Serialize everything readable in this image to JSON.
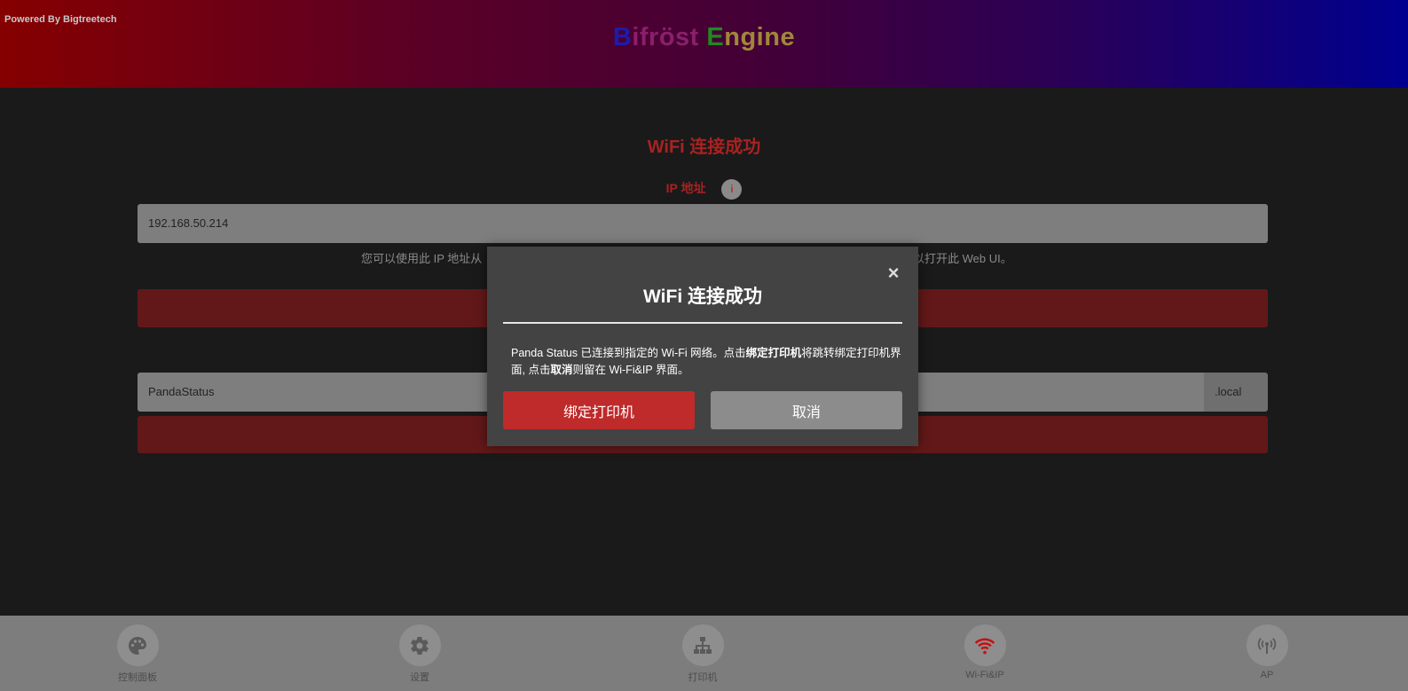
{
  "header": {
    "powered_by": "Powered By Bigtreetech",
    "brand_parts": [
      "B",
      "ifröst",
      " E",
      "ngine"
    ]
  },
  "main": {
    "title": "WiFi 连接成功",
    "ip_label": "IP 地址",
    "info_icon": "i",
    "ip_value": "192.168.50.214",
    "ip_hint_left": "您可以使用此 IP 地址从",
    "ip_hint_right": "中，以打开此 Web UI。",
    "hostname_value": "PandaStatus",
    "hostname_suffix": ".local"
  },
  "modal": {
    "title": "WiFi 连接成功",
    "close_icon": "×",
    "body_part1": "Panda Status 已连接到指定的 Wi-Fi 网络。点击",
    "body_bold1": "绑定打印机",
    "body_part2": "将跳转绑定打印机界面, 点击",
    "body_bold2": "取消",
    "body_part3": "则留在 Wi-Fi&IP 界面。",
    "bind_button": "绑定打印机",
    "cancel_button": "取消"
  },
  "nav": {
    "items": [
      {
        "label": "控制面板",
        "icon": "palette-icon"
      },
      {
        "label": "设置",
        "icon": "gear-icon"
      },
      {
        "label": "打印机",
        "icon": "sitemap-icon"
      },
      {
        "label": "Wi-Fi&IP",
        "icon": "wifi-icon"
      },
      {
        "label": "AP",
        "icon": "broadcast-icon"
      }
    ]
  },
  "colors": {
    "accent_red": "#bf2a2a",
    "wifi_active": "#c81010"
  }
}
